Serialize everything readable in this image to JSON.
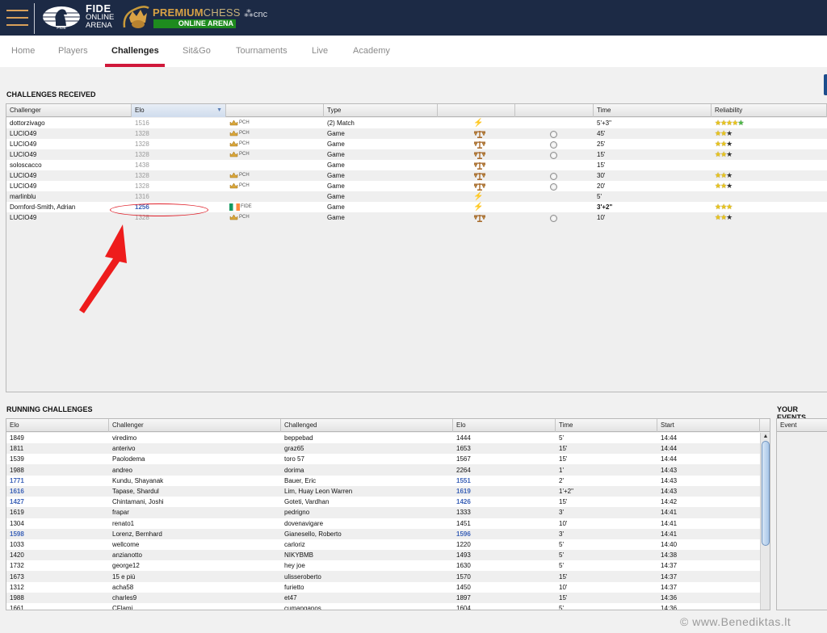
{
  "header": {
    "fide_brand": "FIDE",
    "fide_sub1": "ONLINE",
    "fide_sub2": "ARENA",
    "fide_emblem_label": "FIDE",
    "premium_bold": "PREMIUM",
    "premium_light": "CHESS",
    "premium_sub": "ONLINE ARENA",
    "partner": "cnc"
  },
  "nav": {
    "items": [
      {
        "label": "Home"
      },
      {
        "label": "Players"
      },
      {
        "label": "Challenges",
        "active": true
      },
      {
        "label": "Sit&Go"
      },
      {
        "label": "Tournaments"
      },
      {
        "label": "Live"
      },
      {
        "label": "Academy"
      }
    ]
  },
  "received": {
    "title": "CHALLENGES RECEIVED",
    "columns": [
      "Challenger",
      "Elo",
      "",
      "Type",
      "",
      "",
      "Time",
      "Reliability"
    ],
    "sorted_column": "Elo",
    "rows": [
      {
        "challenger": "dottorzivago",
        "elo": "1516",
        "elo_style": "grey",
        "platform": "PCH",
        "platform_icon": "crown",
        "type": "(2) Match",
        "speed_icon": "bolt",
        "radio": false,
        "time": "5'+3\"",
        "time_bold": false,
        "reliability": [
          "y",
          "y",
          "y",
          "y",
          "g"
        ]
      },
      {
        "challenger": "LUCIO49",
        "elo": "1328",
        "elo_style": "grey",
        "platform": "PCH",
        "platform_icon": "crown",
        "type": "Game",
        "speed_icon": "scale",
        "radio": true,
        "time": "45'",
        "time_bold": false,
        "reliability": [
          "y",
          "y",
          "d"
        ]
      },
      {
        "challenger": "LUCIO49",
        "elo": "1328",
        "elo_style": "grey",
        "platform": "PCH",
        "platform_icon": "crown",
        "type": "Game",
        "speed_icon": "scale",
        "radio": true,
        "time": "25'",
        "time_bold": false,
        "reliability": [
          "y",
          "y",
          "d"
        ]
      },
      {
        "challenger": "LUCIO49",
        "elo": "1328",
        "elo_style": "grey",
        "platform": "PCH",
        "platform_icon": "crown",
        "type": "Game",
        "speed_icon": "scale",
        "radio": true,
        "time": "15'",
        "time_bold": false,
        "reliability": [
          "y",
          "y",
          "d"
        ]
      },
      {
        "challenger": "soloscacco",
        "elo": "1438",
        "elo_style": "grey",
        "platform": "",
        "platform_icon": "",
        "type": "Game",
        "speed_icon": "scale",
        "radio": false,
        "time": "15'",
        "time_bold": false,
        "reliability": []
      },
      {
        "challenger": "LUCIO49",
        "elo": "1328",
        "elo_style": "grey",
        "platform": "PCH",
        "platform_icon": "crown",
        "type": "Game",
        "speed_icon": "scale",
        "radio": true,
        "time": "30'",
        "time_bold": false,
        "reliability": [
          "y",
          "y",
          "d"
        ]
      },
      {
        "challenger": "LUCIO49",
        "elo": "1328",
        "elo_style": "grey",
        "platform": "PCH",
        "platform_icon": "crown",
        "type": "Game",
        "speed_icon": "scale",
        "radio": true,
        "time": "20'",
        "time_bold": false,
        "reliability": [
          "y",
          "y",
          "d"
        ]
      },
      {
        "challenger": "marlinblu",
        "elo": "1316",
        "elo_style": "grey",
        "platform": "",
        "platform_icon": "",
        "type": "Game",
        "speed_icon": "bolt",
        "radio": false,
        "time": "5'",
        "time_bold": false,
        "reliability": []
      },
      {
        "challenger": "Dornford-Smith, Adrian",
        "elo": "1256",
        "elo_style": "blue",
        "platform": "FIDE",
        "platform_icon": "flag-ireland",
        "type": "Game",
        "speed_icon": "bolt",
        "radio": false,
        "time": "3'+2\"",
        "time_bold": true,
        "reliability": [
          "y",
          "y",
          "y"
        ]
      },
      {
        "challenger": "LUCIO49",
        "elo": "1328",
        "elo_style": "grey",
        "platform": "PCH",
        "platform_icon": "crown",
        "type": "Game",
        "speed_icon": "scale",
        "radio": true,
        "time": "10'",
        "time_bold": false,
        "reliability": [
          "y",
          "y",
          "d"
        ]
      }
    ]
  },
  "running": {
    "title": "RUNNING CHALLENGES",
    "columns": [
      "Elo",
      "Challenger",
      "Challenged",
      "Elo",
      "Time",
      "Start"
    ],
    "rows": [
      {
        "elo1": "1849",
        "blue1": false,
        "challenger": "viredimo",
        "challenged": "beppebad",
        "elo2": "1444",
        "blue2": false,
        "time": "5'",
        "start": "14:44"
      },
      {
        "elo1": "1811",
        "blue1": false,
        "challenger": "anterivo",
        "challenged": "graz65",
        "elo2": "1653",
        "blue2": false,
        "time": "15'",
        "start": "14:44"
      },
      {
        "elo1": "1539",
        "blue1": false,
        "challenger": "Paolodema",
        "challenged": "toro 57",
        "elo2": "1567",
        "blue2": false,
        "time": "15'",
        "start": "14:44"
      },
      {
        "elo1": "1988",
        "blue1": false,
        "challenger": "andreo",
        "challenged": "dorima",
        "elo2": "2264",
        "blue2": false,
        "time": "1'",
        "start": "14:43"
      },
      {
        "elo1": "1771",
        "blue1": true,
        "challenger": "Kundu, Shayanak",
        "challenged": "Bauer, Eric",
        "elo2": "1551",
        "blue2": true,
        "time": "2'",
        "start": "14:43"
      },
      {
        "elo1": "1616",
        "blue1": true,
        "challenger": "Tapase, Shardul",
        "challenged": "Lim, Huay Leon Warren",
        "elo2": "1619",
        "blue2": true,
        "time": "1'+2\"",
        "start": "14:43"
      },
      {
        "elo1": "1427",
        "blue1": true,
        "challenger": "Chintamani, Joshi",
        "challenged": "Goteti, Vardhan",
        "elo2": "1426",
        "blue2": true,
        "time": "15'",
        "start": "14:42"
      },
      {
        "elo1": "1619",
        "blue1": false,
        "challenger": "frapar",
        "challenged": "pedrigno",
        "elo2": "1333",
        "blue2": false,
        "time": "3'",
        "start": "14:41"
      },
      {
        "elo1": "1304",
        "blue1": false,
        "challenger": "renato1",
        "challenged": "dovenavigare",
        "elo2": "1451",
        "blue2": false,
        "time": "10'",
        "start": "14:41"
      },
      {
        "elo1": "1598",
        "blue1": true,
        "challenger": "Lorenz, Bernhard",
        "challenged": "Gianesello, Roberto",
        "elo2": "1596",
        "blue2": true,
        "time": "3'",
        "start": "14:41"
      },
      {
        "elo1": "1033",
        "blue1": false,
        "challenger": "wellcome",
        "challenged": "carloriz",
        "elo2": "1220",
        "blue2": false,
        "time": "5'",
        "start": "14:40"
      },
      {
        "elo1": "1420",
        "blue1": false,
        "challenger": "anzianotto",
        "challenged": "NIKYBMB",
        "elo2": "1493",
        "blue2": false,
        "time": "5'",
        "start": "14:38"
      },
      {
        "elo1": "1732",
        "blue1": false,
        "challenger": "george12",
        "challenged": "hey joe",
        "elo2": "1630",
        "blue2": false,
        "time": "5'",
        "start": "14:37"
      },
      {
        "elo1": "1673",
        "blue1": false,
        "challenger": "15 e più",
        "challenged": "ulisseroberto",
        "elo2": "1570",
        "blue2": false,
        "time": "15'",
        "start": "14:37"
      },
      {
        "elo1": "1312",
        "blue1": false,
        "challenger": "acha58",
        "challenged": "furietto",
        "elo2": "1450",
        "blue2": false,
        "time": "10'",
        "start": "14:37"
      },
      {
        "elo1": "1988",
        "blue1": false,
        "challenger": "charles9",
        "challenged": "et47",
        "elo2": "1897",
        "blue2": false,
        "time": "15'",
        "start": "14:36"
      },
      {
        "elo1": "1661",
        "blue1": false,
        "challenger": "CFlami",
        "challenged": "cumanganos",
        "elo2": "1604",
        "blue2": false,
        "time": "5'",
        "start": "14:36"
      }
    ]
  },
  "events": {
    "title": "YOUR EVENTS",
    "columns": [
      "Event"
    ]
  },
  "watermark": "©  www.Benediktas.lt",
  "colors": {
    "topbar": "#1c2a45",
    "accent_underline": "#d0183a",
    "elo_blue": "#3d63b8",
    "annotation_red": "#e0202a"
  }
}
